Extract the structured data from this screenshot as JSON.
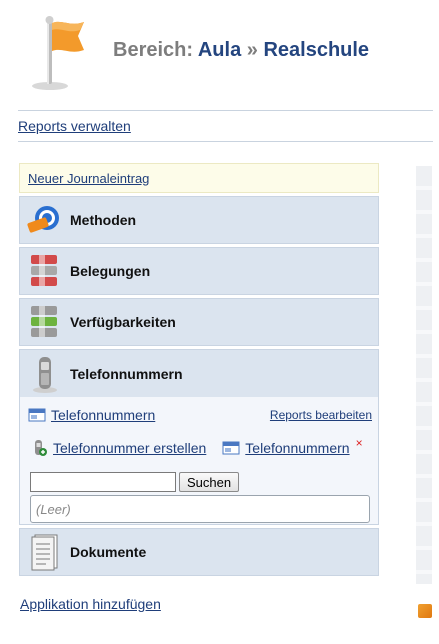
{
  "header": {
    "prefix": "Bereich:",
    "crumb1": "Aula",
    "separator": "»",
    "crumb2": "Realschule",
    "icon": "orange-flag-icon"
  },
  "reports_link": "Reports verwalten",
  "panel": {
    "journal_link": "Neuer Journaleintrag",
    "categories": [
      {
        "label": "Methoden",
        "icon": "methods-icon"
      },
      {
        "label": "Belegungen",
        "icon": "bookings-icon"
      },
      {
        "label": "Verfügbarkeiten",
        "icon": "availability-icon"
      },
      {
        "label": "Telefonnummern",
        "icon": "phone-icon"
      },
      {
        "label": "Dokumente",
        "icon": "document-icon"
      }
    ],
    "expanded": {
      "list_link": "Telefonnummern",
      "edit_reports": "Reports bearbeiten",
      "create_link": "Telefonnummer erstellen",
      "view_link": "Telefonnummern",
      "delete_mark": "×",
      "search_value": "",
      "search_button": "Suchen",
      "empty_text": "(Leer)"
    }
  },
  "add_app_link": "Applikation hinzufügen",
  "colors": {
    "title_blue": "#24457f",
    "title_grey": "#7d7d7d",
    "category_bg": "#dbe4ef",
    "journal_bg": "#fdfce9"
  }
}
